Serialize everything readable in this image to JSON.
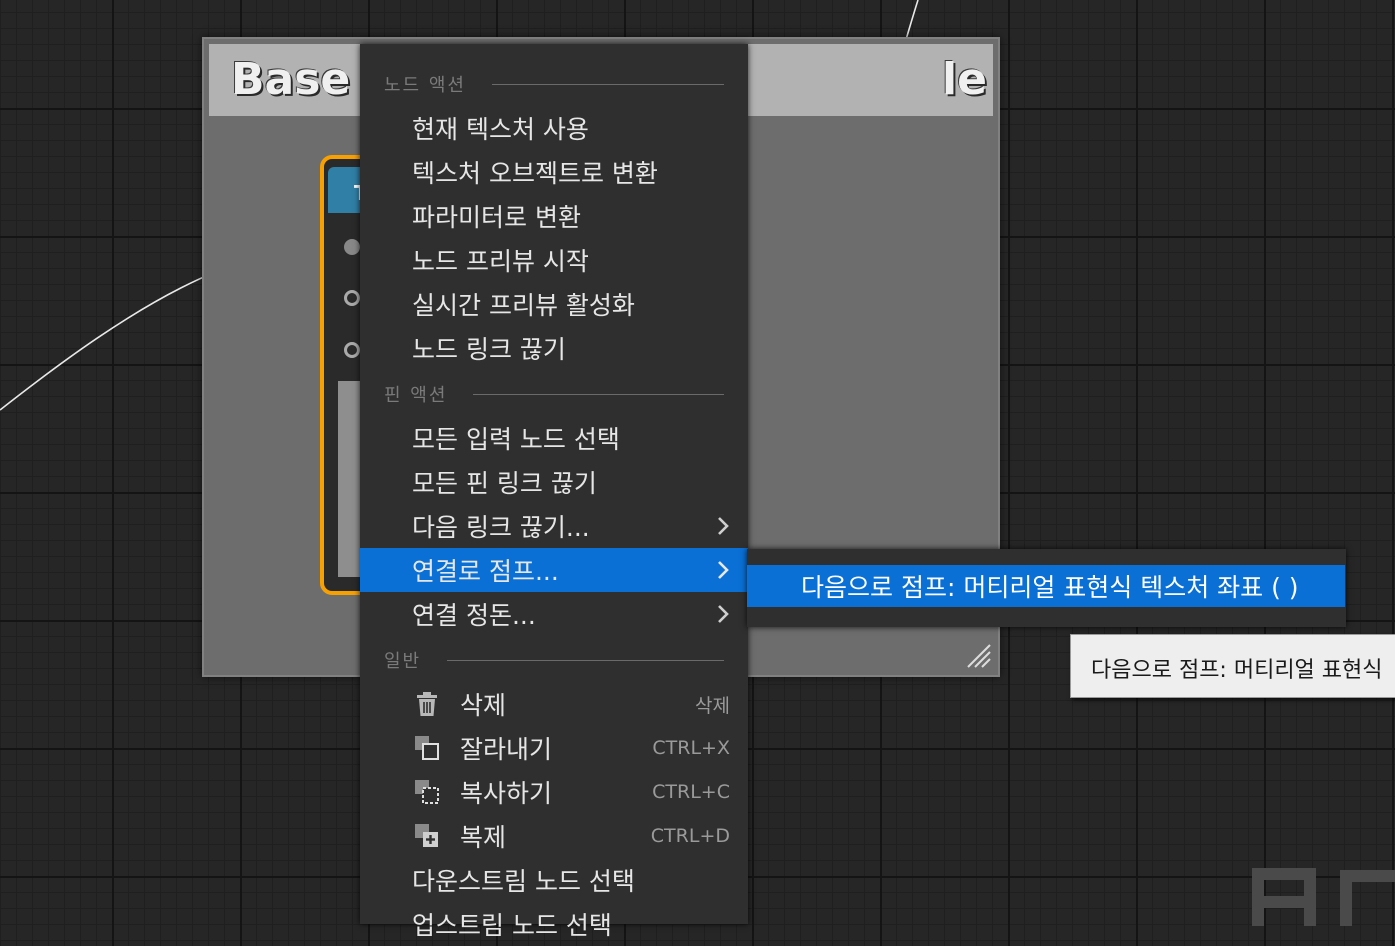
{
  "comment": {
    "title_start": "Base C",
    "title_end": "le"
  },
  "node": {
    "header_letter": "T"
  },
  "menu": {
    "sections": {
      "node_actions": "노드 액션",
      "pin_actions": "핀 액션",
      "general": "일반"
    },
    "node_actions": [
      {
        "label": "현재 텍스처 사용"
      },
      {
        "label": "텍스처 오브젝트로 변환"
      },
      {
        "label": "파라미터로 변환"
      },
      {
        "label": "노드 프리뷰 시작"
      },
      {
        "label": "실시간 프리뷰 활성화"
      },
      {
        "label": "노드 링크 끊기"
      }
    ],
    "pin_actions": [
      {
        "label": "모든 입력 노드 선택"
      },
      {
        "label": "모든 핀 링크 끊기"
      },
      {
        "label": "다음 링크 끊기..."
      },
      {
        "label": "연결로 점프..."
      },
      {
        "label": "연결 정돈..."
      }
    ],
    "general": [
      {
        "label": "삭제",
        "shortcut": "삭제",
        "icon": "trash-icon"
      },
      {
        "label": "잘라내기",
        "shortcut": "CTRL+X",
        "icon": "cut-icon"
      },
      {
        "label": "복사하기",
        "shortcut": "CTRL+C",
        "icon": "copy-icon"
      },
      {
        "label": "복제",
        "shortcut": "CTRL+D",
        "icon": "duplicate-icon"
      },
      {
        "label": "다운스트림 노드 선택"
      },
      {
        "label": "업스트림 노드 선택"
      }
    ]
  },
  "submenu": {
    "item": "다음으로 점프: 머티리얼 표현식 텍스처 좌표 ( )"
  },
  "tooltip": {
    "text": "다음으로 점프: 머티리얼 표현식"
  },
  "colors": {
    "highlight": "#0a70d6",
    "node_border": "#f7a000",
    "menu_bg": "#2f2f2f"
  }
}
